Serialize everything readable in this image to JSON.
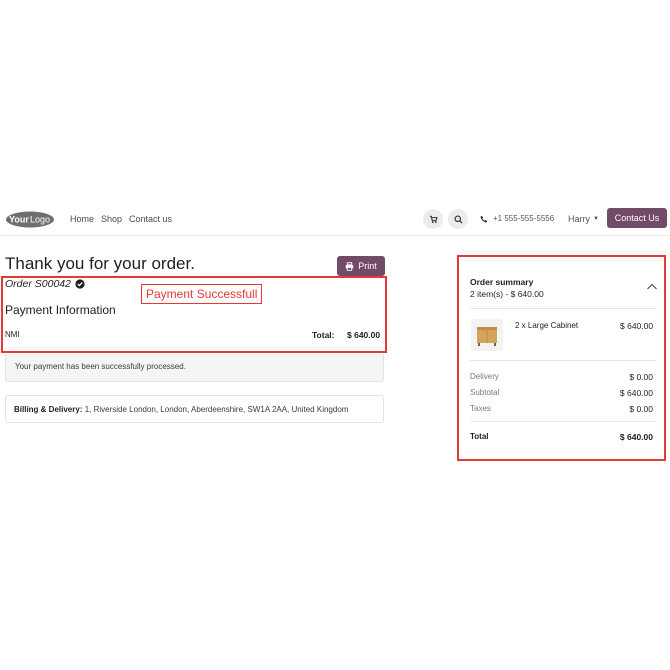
{
  "brand": {
    "logo_text": "YourLogo"
  },
  "nav": {
    "links": [
      "Home",
      "Shop",
      "Contact us"
    ],
    "phone": "+1 555-555-5556",
    "user": "Harry",
    "contact_button": "Contact Us"
  },
  "colors": {
    "accent": "#714b67",
    "highlight": "#e53935"
  },
  "icons": {
    "cart": "cart-icon",
    "search": "search-icon",
    "phone": "phone-icon",
    "print": "print-icon",
    "check": "check-circle-icon",
    "collapse": "chevron-up-icon"
  },
  "order": {
    "title": "Thank you for your order.",
    "print_label": "Print",
    "order_number": "Order S00042",
    "callout": "Payment Successfull",
    "payment_heading": "Payment Information",
    "provider": "NMI",
    "total_label": "Total:",
    "total_value": "$ 640.00",
    "success_message": "Your payment has been successfully processed.",
    "billing_label": "Billing & Delivery:",
    "billing_address": "1, Riverside London, London, Aberdeenshire, SW1A 2AA, United Kingdom"
  },
  "summary": {
    "title": "Order summary",
    "item_count": "2 item(s) -  $ 640.00",
    "items": [
      {
        "name": "2 x Large Cabinet",
        "price": "$ 640.00"
      }
    ],
    "rows": [
      {
        "label": "Delivery",
        "value": "$ 0.00"
      },
      {
        "label": "Subtotal",
        "value": "$ 640.00"
      },
      {
        "label": "Taxes",
        "value": "$ 0.00"
      }
    ],
    "total_label": "Total",
    "total_value": "$ 640.00"
  }
}
